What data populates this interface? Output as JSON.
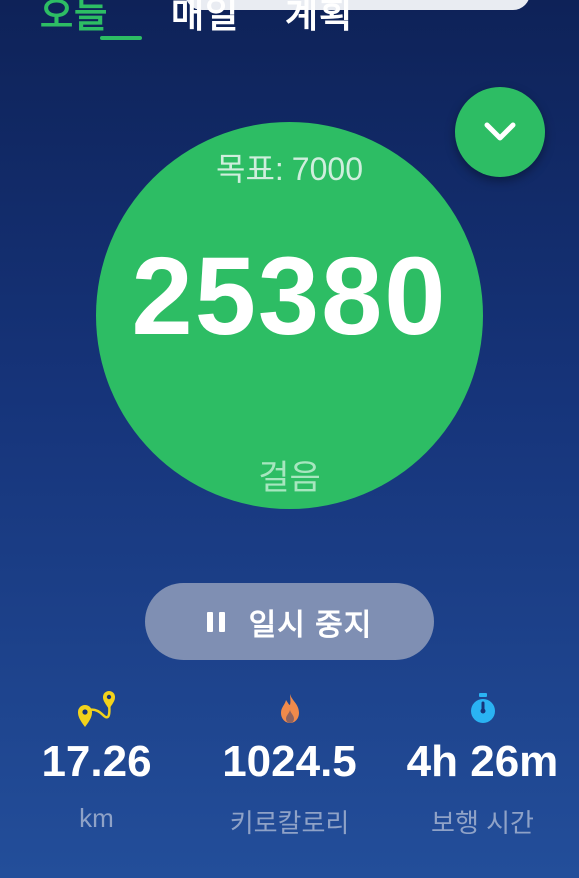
{
  "tabs": [
    {
      "label": "오늘",
      "active": true
    },
    {
      "label": "매일",
      "active": false
    },
    {
      "label": "계획",
      "active": false
    }
  ],
  "colors": {
    "accent": "#2dbd64",
    "background_top": "#0e2258",
    "background_bottom": "#234e9a",
    "pause_button": "#7f8fb3",
    "distance_icon": "#f2d21b",
    "calorie_icon": "#f08a4b",
    "time_icon": "#2ab3f3"
  },
  "step_counter": {
    "goal_label": "목표:",
    "goal_value": "7000",
    "steps": "25380",
    "unit": "걸음"
  },
  "collapse_button": {
    "icon": "chevron-down-icon"
  },
  "pause_button": {
    "icon": "pause-icon",
    "label": "일시 중지"
  },
  "stats": [
    {
      "icon": "route-pin-icon",
      "value": "17.26",
      "unit": "km"
    },
    {
      "icon": "flame-icon",
      "value": "1024.5",
      "unit": "키로칼로리"
    },
    {
      "icon": "stopwatch-icon",
      "value": "4h 26m",
      "unit": "보행 시간"
    }
  ]
}
